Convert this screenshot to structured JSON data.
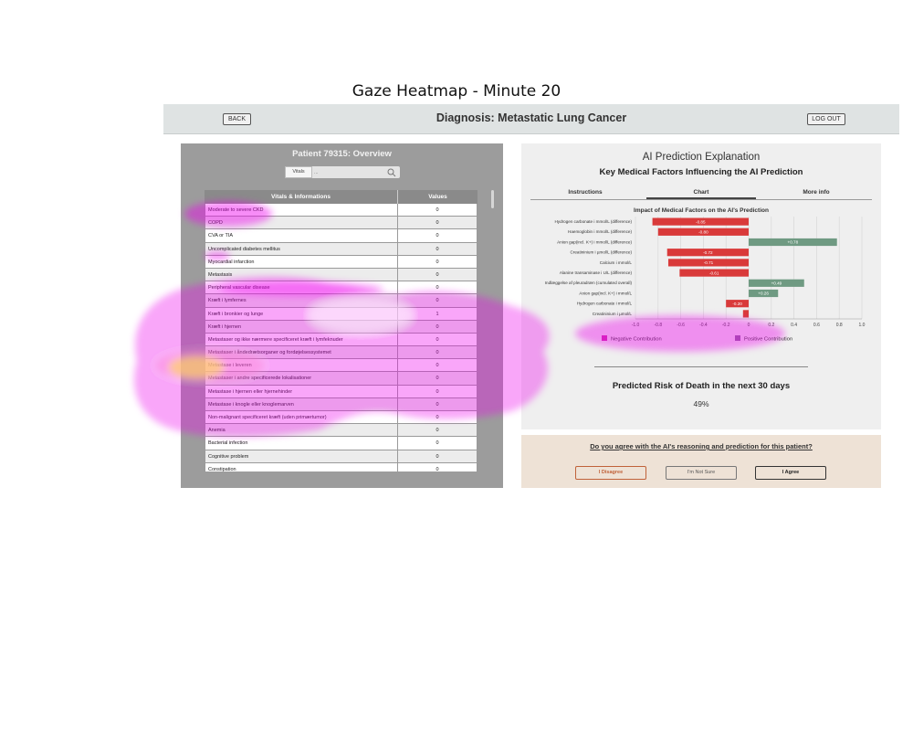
{
  "figure_title": "Gaze Heatmap - Minute 20",
  "topbar": {
    "back": "BACK",
    "title": "Diagnosis: Metastatic Lung Cancer",
    "logout": "LOG OUT"
  },
  "patient": {
    "title": "Patient 79315: Overview",
    "search_select": "Vitals",
    "search_placeholder": "...",
    "table_headers": [
      "Vitals & Informations",
      "Values"
    ],
    "rows": [
      [
        "Moderate to severe CKD",
        "0"
      ],
      [
        "COPD",
        "0"
      ],
      [
        "CVA or TIA",
        "0"
      ],
      [
        "Uncomplicated diabetes mellitus",
        "0"
      ],
      [
        "Myocardial infarction",
        "0"
      ],
      [
        "Metastasis",
        "0"
      ],
      [
        "Peripheral vascular disease",
        "0"
      ],
      [
        "Kræft i lymfernes",
        "0"
      ],
      [
        "Kræft i bronkier og lunge",
        "1"
      ],
      [
        "Kræft i hjernen",
        "0"
      ],
      [
        "Metastaser og ikke nærmere specificeret kræft i lymfeknuder",
        "0"
      ],
      [
        "Metastaser i åndedrætsorganer og fordøjelsessystemet",
        "0"
      ],
      [
        "Metastase i leveren",
        "0"
      ],
      [
        "Metastaser i andre specificerede lokalisationer",
        "0"
      ],
      [
        "Metastase i hjernen eller hjernehinder",
        "0"
      ],
      [
        "Metastase i knogle eller knoglemarven",
        "0"
      ],
      [
        "Non-malignant specificeret kræft (uden primærtumor)",
        "0"
      ],
      [
        "Anemia",
        "0"
      ],
      [
        "Bacterial infection",
        "0"
      ],
      [
        "Cognitive problem",
        "0"
      ],
      [
        "Constipation",
        "0"
      ]
    ]
  },
  "ai": {
    "title": "AI Prediction Explanation",
    "subtitle": "Key Medical Factors Influencing the AI Prediction",
    "tabs": [
      "Instructions",
      "Chart",
      "More info"
    ],
    "active_tab": "Chart",
    "risk_label": "Predicted Risk of Death in the next 30 days",
    "risk_value": "49%"
  },
  "agree": {
    "question": "Do you agree with the AI's reasoning and prediction for this patient?",
    "disagree": "I Disagree",
    "not_sure": "I'm Not Sure",
    "agree": "I Agree"
  },
  "chart_data": {
    "type": "bar",
    "orientation": "horizontal",
    "title": "Impact of Medical Factors on the AI's Prediction",
    "categories": [
      "Hydrogen carbonate i mmol/L (difference)",
      "Haemoglobin i mmol/L (difference)",
      "Anion gap(incl. K+) i mmol/L (difference)",
      "Creatininium i µmol/L (difference)",
      "Calcium i mmol/L",
      "Alanine transaminase i U/L (difference)",
      "Indlæggelse af pleuradræn (cumulated overall)",
      "Anion gap(incl. K+) i mmol/L",
      "Hydrogen carbonate i mmol/L",
      "Creatininium i µmol/L"
    ],
    "values": [
      -0.85,
      -0.8,
      0.78,
      -0.72,
      -0.71,
      -0.61,
      0.49,
      0.26,
      -0.2,
      -0.05
    ],
    "value_labels": [
      "-0.85",
      "-0.80",
      "+0.78",
      "-0.72",
      "-0.71",
      "-0.61",
      "+0.49",
      "+0.26",
      "-0.20",
      ""
    ],
    "xlim": [
      -1.0,
      1.0
    ],
    "xticks": [
      "-1.0",
      "-0.8",
      "-0.6",
      "-0.4",
      "-0.2",
      "0",
      "0.2",
      "0.4",
      "0.6",
      "0.8",
      "1.0"
    ],
    "grid": true,
    "legend": [
      "Negative Contribution",
      "Positive Contribution"
    ],
    "legend_position": "bottom",
    "colors": {
      "negative": "#d93a3a",
      "positive": "#6f9a82"
    }
  },
  "heatmap_colors": {
    "outer": "#ee00ee",
    "hot": "#ffff33"
  }
}
